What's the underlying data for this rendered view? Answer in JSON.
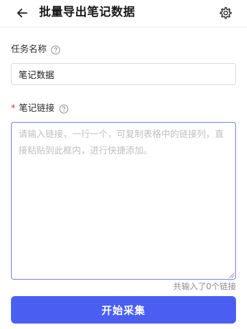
{
  "header": {
    "title": "批量导出笔记数据",
    "back_icon": "arrow-left-icon",
    "settings_icon": "gear-icon"
  },
  "task_name": {
    "label": "任务名称",
    "value": "笔记数据",
    "help_icon": "question-circle-icon"
  },
  "note_links": {
    "required_mark": "*",
    "label": "笔记链接",
    "placeholder": "请输入链接，一行一个，可复制表格中的链接列，直接粘贴到此框内，进行快捷添加。",
    "value": "",
    "help_icon": "question-circle-icon",
    "count_text": "共输入了0个链接"
  },
  "actions": {
    "start_label": "开始采集"
  },
  "colors": {
    "primary": "#4a5ff2",
    "textarea_focus_border": "#6d7df5",
    "required": "#e0312f",
    "muted_text": "#8c8c8c"
  }
}
